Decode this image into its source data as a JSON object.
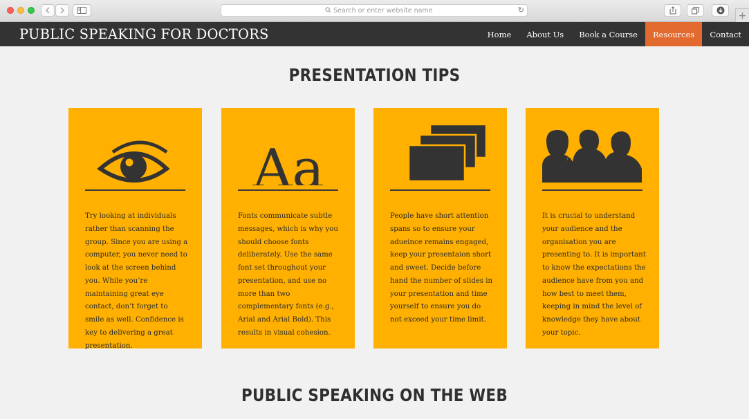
{
  "browser": {
    "address_placeholder": "Search or enter website name"
  },
  "site": {
    "brand": "PUBLIC SPEAKING FOR DOCTORS",
    "nav": [
      "Home",
      "About Us",
      "Book a Course",
      "Resources",
      "Contact"
    ],
    "active_nav": "Resources",
    "accent_color": "#e36a2e",
    "card_color": "#ffb000",
    "navbar_color": "#333333"
  },
  "main": {
    "heading": "PRESENTATION TIPS",
    "cards": [
      {
        "icon": "eye-icon",
        "text": "Try looking at individuals rather than scanning the group. Since you are using a computer, you never need to look at the screen behind you. While you’re maintaining great eye contact, don’t forget to smile as well. Confidence is key to delivering a great presentation."
      },
      {
        "icon": "font-icon",
        "icon_text": "Aa",
        "text": "Fonts communicate subtle messages, which is why you should choose fonts deliberately. Use the same font set throughout your presentation, and use no more than two complementary fonts (e.g., Arial and Arial Bold). This results in visual cohesion."
      },
      {
        "icon": "slides-icon",
        "text": "People have short attention spans so to ensure your adueince remains engaged, keep your presentaion short and sweet. Decide before hand the number of slides in your presentation and time yourself to ensure you do not exceed your time limit."
      },
      {
        "icon": "audience-icon",
        "text": "It is crucial to understand your audience and the organisation you are presenting to. It is important to know the expectations the audience have from you and how best to meet them, keeping in mind the level of knowledge they have about your topic."
      }
    ],
    "heading2": "PUBLIC SPEAKING ON THE WEB"
  }
}
